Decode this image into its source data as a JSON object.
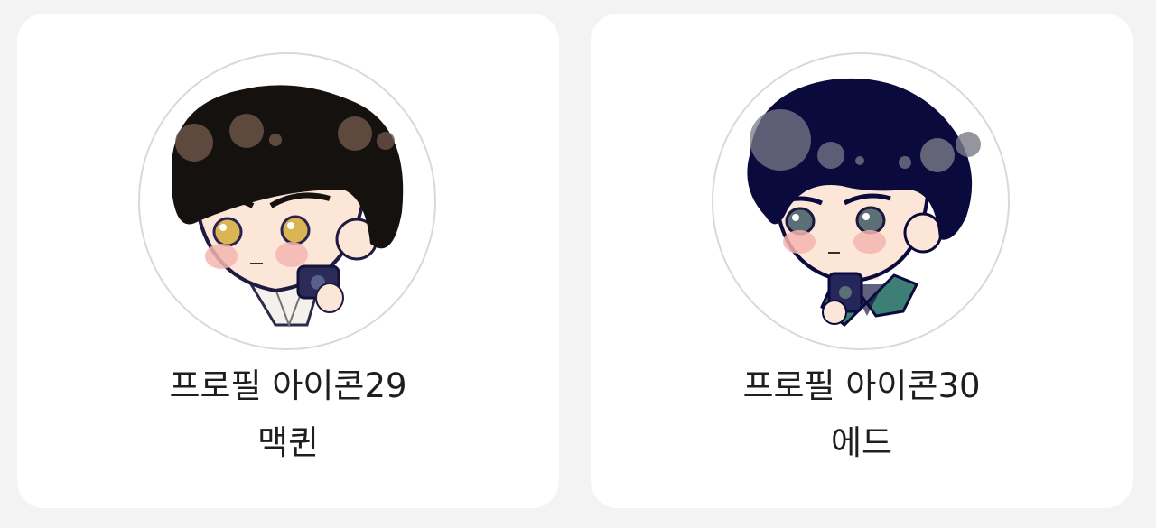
{
  "cards": [
    {
      "title": "프로필 아이콘29",
      "name": "맥퀸",
      "hair_color": "#15110f",
      "eye_color": "#d9b553",
      "clothing_color": "#f4f0ec"
    },
    {
      "title": "프로필 아이콘30",
      "name": "에드",
      "hair_color": "#0b0a3c",
      "eye_color": "#5d6f76",
      "clothing_color": "#3d7f74"
    }
  ],
  "colors": {
    "page_background": "#f3f3f3",
    "card_background": "#ffffff",
    "avatar_ring": "#d9d9d9",
    "text": "#1e1e1e",
    "skin": "#fbe6d8",
    "blush": "#f5b5b0",
    "bokeh": "#6b5348"
  }
}
